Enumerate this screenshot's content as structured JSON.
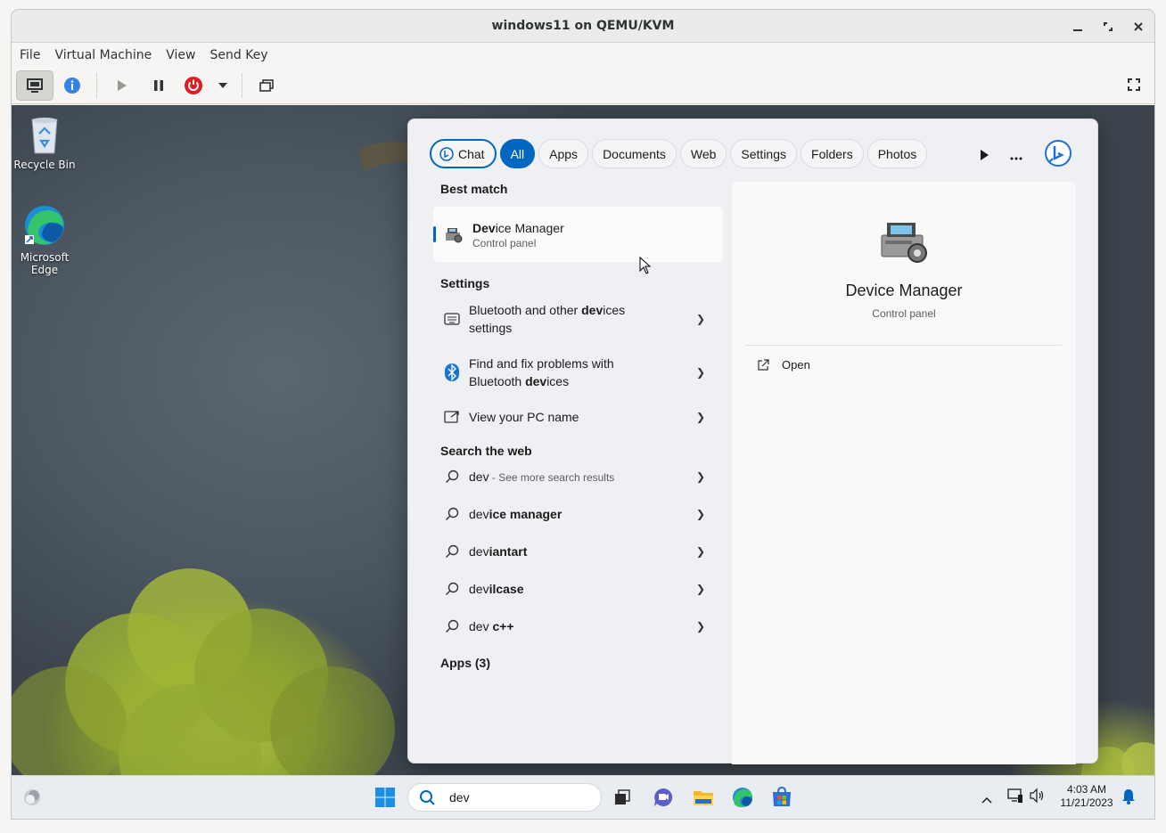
{
  "window": {
    "title": "windows11 on QEMU/KVM"
  },
  "menubar": [
    "File",
    "Virtual Machine",
    "View",
    "Send Key"
  ],
  "desktop": {
    "icons": [
      {
        "label": "Recycle Bin"
      },
      {
        "label": "Microsoft Edge"
      }
    ]
  },
  "search_panel": {
    "tabs": [
      "Chat",
      "All",
      "Apps",
      "Documents",
      "Web",
      "Settings",
      "Folders",
      "Photos"
    ],
    "selected_tab": "All",
    "best_match_header": "Best match",
    "best_match": {
      "title_bold": "Dev",
      "title_rest": "ice Manager",
      "subtitle": "Control panel"
    },
    "settings_header": "Settings",
    "settings_items": [
      {
        "line1_pre": "Bluetooth and other ",
        "bold": "dev",
        "line1_post": "ices",
        "line2": "settings"
      },
      {
        "line1": "Find and fix problems with",
        "line2_pre": "Bluetooth ",
        "bold": "dev",
        "line2_post": "ices"
      },
      {
        "line1": "View your PC name"
      }
    ],
    "web_header": "Search the web",
    "web_items": [
      {
        "pre": "dev",
        "bold": "",
        "suffix": " - See more search results"
      },
      {
        "pre": "dev",
        "bold": "ice manager",
        "suffix": ""
      },
      {
        "pre": "dev",
        "bold": "iantart",
        "suffix": ""
      },
      {
        "pre": "dev",
        "bold": "ilcase",
        "suffix": ""
      },
      {
        "pre": "dev",
        "bold": " c++",
        "suffix": ""
      }
    ],
    "apps_header": "Apps (3)",
    "preview": {
      "title": "Device Manager",
      "subtitle": "Control panel",
      "action": "Open"
    }
  },
  "taskbar": {
    "search_value": "dev",
    "time": "4:03 AM",
    "date": "11/21/2023"
  }
}
